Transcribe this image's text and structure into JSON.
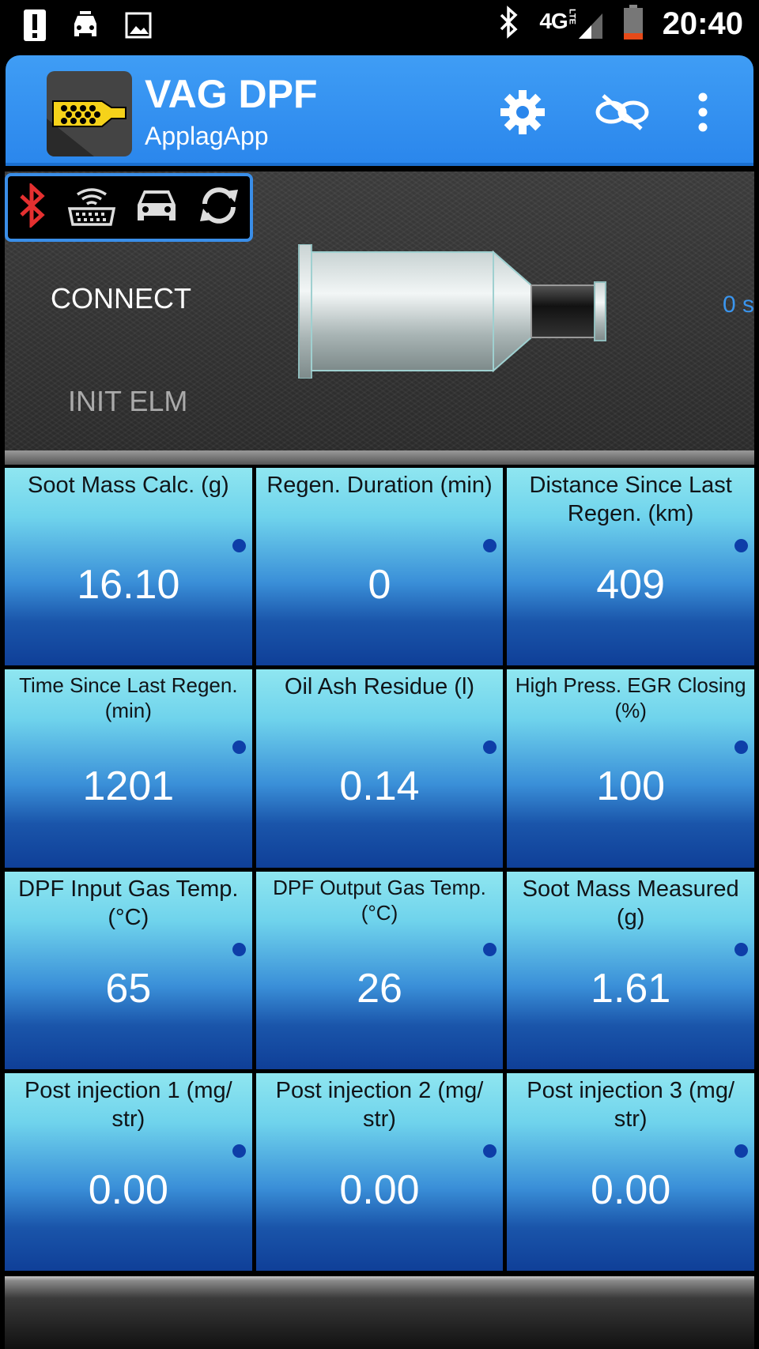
{
  "status_bar": {
    "time": "20:40",
    "network": "4G",
    "network_sub": "LTE",
    "left_icons": [
      "alert-icon",
      "car-icon",
      "image-icon"
    ],
    "right_icons": [
      "bluetooth-icon",
      "signal-icon",
      "battery-icon"
    ]
  },
  "app_bar": {
    "title": "VAG DPF",
    "subtitle": "ApplagApp",
    "actions": [
      "settings-icon",
      "disconnect-icon",
      "overflow-menu-icon"
    ]
  },
  "connection_panel": {
    "icons": [
      "bluetooth-icon",
      "obd-adapter-icon",
      "car-icon",
      "refresh-icon"
    ],
    "connect_label": "CONNECT",
    "init_label": "INIT ELM",
    "timer": "0 s"
  },
  "tiles": [
    {
      "label": "Soot Mass Calc. (g)",
      "value": "16.10"
    },
    {
      "label": "Regen. Duration (min)",
      "value": "0"
    },
    {
      "label": "Distance Since Last Regen. (km)",
      "value": "409"
    },
    {
      "label": "Time Since Last Regen. (min)",
      "value": "1201"
    },
    {
      "label": "Oil Ash Residue (l)",
      "value": "0.14"
    },
    {
      "label": "High Press. EGR Closing (%)",
      "value": "100"
    },
    {
      "label": "DPF Input Gas Temp. (°C)",
      "value": "65"
    },
    {
      "label": "DPF Output Gas Temp. (°C)",
      "value": "26"
    },
    {
      "label": "Soot Mass Measured (g)",
      "value": "1.61"
    },
    {
      "label": "Post injection 1 (mg/ str)",
      "value": "0.00"
    },
    {
      "label": "Post injection 2 (mg/ str)",
      "value": "0.00"
    },
    {
      "label": "Post injection 3 (mg/ str)",
      "value": "0.00"
    }
  ],
  "colors": {
    "accent": "#2a86ec",
    "bluetooth_active": "#e53030",
    "timer": "#3a95ee",
    "tile_top": "#8fe6f0",
    "tile_bottom": "#0f3f98"
  }
}
